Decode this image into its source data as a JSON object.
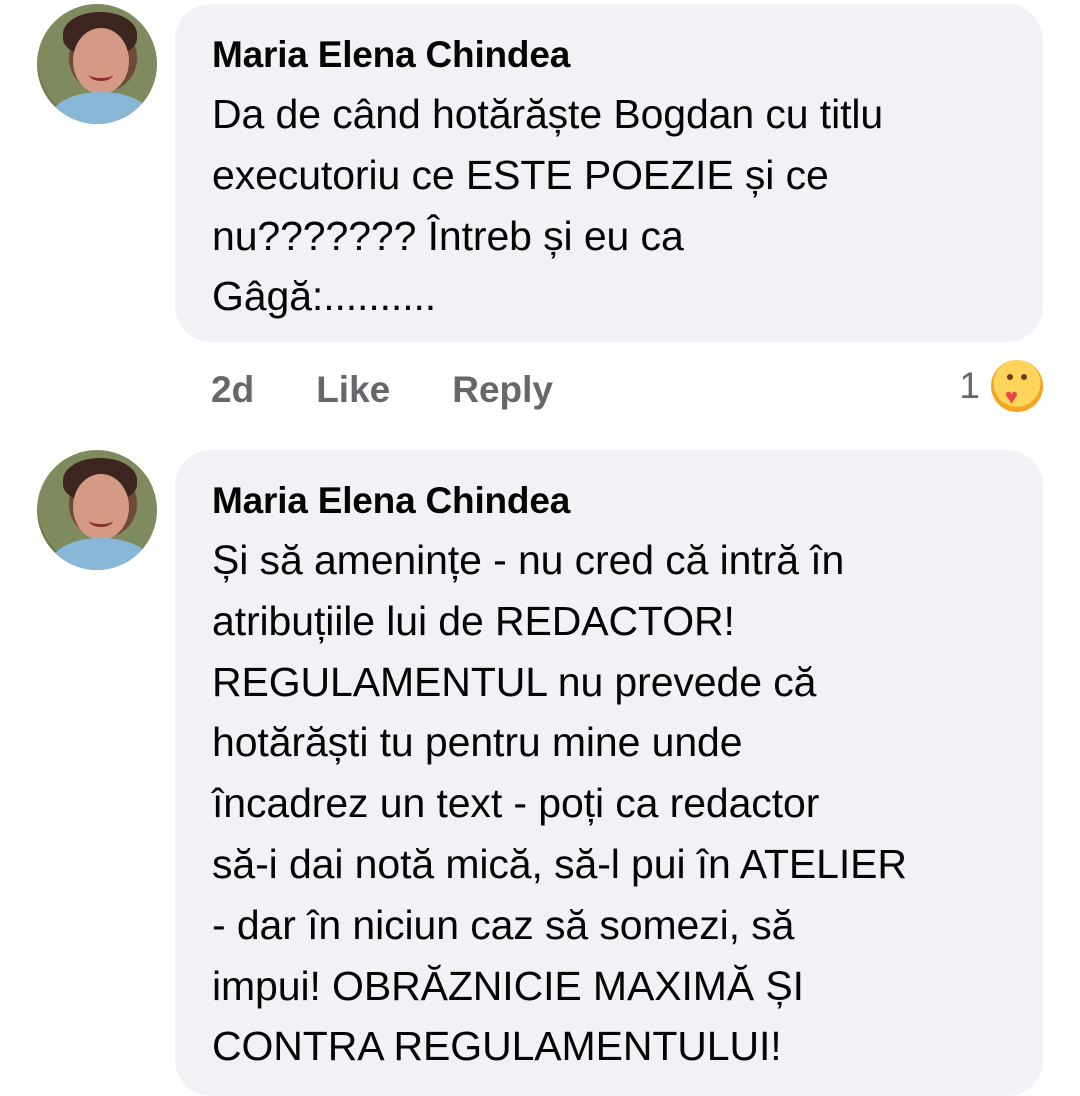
{
  "comments": [
    {
      "author": "Maria Elena Chindea",
      "text": "Da de când hotărăște Bogdan cu titlu\nexecutoriu ce ESTE POEZIE și ce\nnu??????? Întreb și eu ca\nGâgă:..........",
      "time": "2d",
      "like_label": "Like",
      "reply_label": "Reply",
      "reaction_count": "1",
      "reaction_icon": "care-icon"
    },
    {
      "author": "Maria Elena Chindea",
      "text": "Și să amenințe - nu cred că intră în\natribuțiile lui de REDACTOR!\nREGULAMENTUL nu prevede că\nhotărăști tu pentru mine unde\nîncadrez un text - poți ca redactor\nsă-i dai notă mică, să-l pui în ATELIER\n- dar în niciun caz să somezi, să\nimpui! OBRĂZNICIE MAXIMĂ ȘI\nCONTRA REGULAMENTULUI!"
    }
  ],
  "colors": {
    "bubble_bg": "#f0f2f5",
    "meta_text": "#65676b",
    "text": "#050505"
  }
}
